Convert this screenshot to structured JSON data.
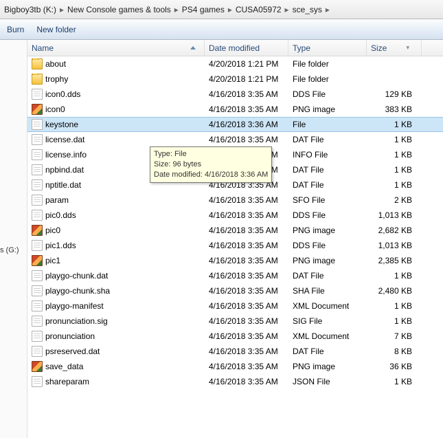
{
  "breadcrumb": [
    "Bigboy3tb (K:)",
    "New Console games & tools",
    "PS4 games",
    "CUSA05972",
    "sce_sys"
  ],
  "toolbar": {
    "burn": "Burn",
    "new_folder": "New folder"
  },
  "tree_stub": "s (G:)",
  "headers": {
    "name": "Name",
    "date": "Date modified",
    "type": "Type",
    "size": "Size"
  },
  "tooltip": {
    "l1": "Type: File",
    "l2": "Size: 96 bytes",
    "l3": "Date modified: 4/16/2018 3:36 AM"
  },
  "rows": [
    {
      "icon": "folder",
      "name": "about",
      "date": "4/20/2018 1:21 PM",
      "type": "File folder",
      "size": "",
      "sel": false
    },
    {
      "icon": "folder",
      "name": "trophy",
      "date": "4/20/2018 1:21 PM",
      "type": "File folder",
      "size": "",
      "sel": false
    },
    {
      "icon": "file",
      "name": "icon0.dds",
      "date": "4/16/2018 3:35 AM",
      "type": "DDS File",
      "size": "129 KB",
      "sel": false
    },
    {
      "icon": "img",
      "name": "icon0",
      "date": "4/16/2018 3:35 AM",
      "type": "PNG image",
      "size": "383 KB",
      "sel": false
    },
    {
      "icon": "file",
      "name": "keystone",
      "date": "4/16/2018 3:36 AM",
      "type": "File",
      "size": "1 KB",
      "sel": true
    },
    {
      "icon": "file",
      "name": "license.dat",
      "date": "4/16/2018 3:35 AM",
      "type": "DAT File",
      "size": "1 KB",
      "sel": false
    },
    {
      "icon": "file",
      "name": "license.info",
      "date": "4/16/2018 3:35 AM",
      "type": "INFO File",
      "size": "1 KB",
      "sel": false
    },
    {
      "icon": "file",
      "name": "npbind.dat",
      "date": "4/16/2018 3:35 AM",
      "type": "DAT File",
      "size": "1 KB",
      "sel": false
    },
    {
      "icon": "file",
      "name": "nptitle.dat",
      "date": "4/16/2018 3:35 AM",
      "type": "DAT File",
      "size": "1 KB",
      "sel": false
    },
    {
      "icon": "file",
      "name": "param",
      "date": "4/16/2018 3:35 AM",
      "type": "SFO File",
      "size": "2 KB",
      "sel": false
    },
    {
      "icon": "file",
      "name": "pic0.dds",
      "date": "4/16/2018 3:35 AM",
      "type": "DDS File",
      "size": "1,013 KB",
      "sel": false
    },
    {
      "icon": "img",
      "name": "pic0",
      "date": "4/16/2018 3:35 AM",
      "type": "PNG image",
      "size": "2,682 KB",
      "sel": false
    },
    {
      "icon": "file",
      "name": "pic1.dds",
      "date": "4/16/2018 3:35 AM",
      "type": "DDS File",
      "size": "1,013 KB",
      "sel": false
    },
    {
      "icon": "img",
      "name": "pic1",
      "date": "4/16/2018 3:35 AM",
      "type": "PNG image",
      "size": "2,385 KB",
      "sel": false
    },
    {
      "icon": "file",
      "name": "playgo-chunk.dat",
      "date": "4/16/2018 3:35 AM",
      "type": "DAT File",
      "size": "1 KB",
      "sel": false
    },
    {
      "icon": "file",
      "name": "playgo-chunk.sha",
      "date": "4/16/2018 3:35 AM",
      "type": "SHA File",
      "size": "2,480 KB",
      "sel": false
    },
    {
      "icon": "file",
      "name": "playgo-manifest",
      "date": "4/16/2018 3:35 AM",
      "type": "XML Document",
      "size": "1 KB",
      "sel": false
    },
    {
      "icon": "file",
      "name": "pronunciation.sig",
      "date": "4/16/2018 3:35 AM",
      "type": "SIG File",
      "size": "1 KB",
      "sel": false
    },
    {
      "icon": "file",
      "name": "pronunciation",
      "date": "4/16/2018 3:35 AM",
      "type": "XML Document",
      "size": "7 KB",
      "sel": false
    },
    {
      "icon": "file",
      "name": "psreserved.dat",
      "date": "4/16/2018 3:35 AM",
      "type": "DAT File",
      "size": "8 KB",
      "sel": false
    },
    {
      "icon": "img",
      "name": "save_data",
      "date": "4/16/2018 3:35 AM",
      "type": "PNG image",
      "size": "36 KB",
      "sel": false
    },
    {
      "icon": "file",
      "name": "shareparam",
      "date": "4/16/2018 3:35 AM",
      "type": "JSON File",
      "size": "1 KB",
      "sel": false
    }
  ]
}
